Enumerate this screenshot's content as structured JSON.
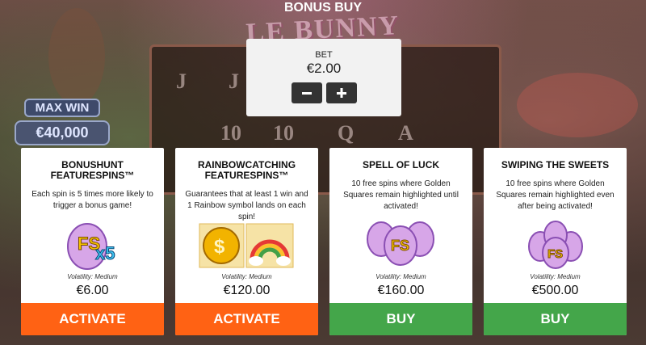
{
  "header": {
    "title": "BONUS BUY"
  },
  "background": {
    "logo_text": "LE BUNNY",
    "max_win_label": "MAX WIN",
    "max_win_value": "€40,000",
    "reel_symbols": [
      "J",
      "J",
      "10",
      "10",
      "Q",
      "A"
    ]
  },
  "bet": {
    "label": "BET",
    "value": "€2.00",
    "decrease_icon": "minus-icon",
    "increase_icon": "plus-icon"
  },
  "colors": {
    "activate": "#ff6214",
    "buy": "#44a64a",
    "panel": "#f2f2f2"
  },
  "cards": [
    {
      "title_line1": "BONUSHUNT",
      "title_line2": "FEATURESPINS™",
      "description": "Each spin is 5 times more likely to trigger a bonus game!",
      "art_text": "FS",
      "art_multiplier": "x5",
      "volatility": "Volatility: Medium",
      "price": "€6.00",
      "action": "ACTIVATE"
    },
    {
      "title_line1": "RAINBOWCATCHING",
      "title_line2": "FEATURESPINS™",
      "description": "Guarantees that at least 1 win and 1 Rainbow symbol lands on each spin!",
      "art_text": "$",
      "volatility": "Volatility: Medium",
      "price": "€120.00",
      "action": "ACTIVATE"
    },
    {
      "title_line1": "SPELL OF LUCK",
      "title_line2": "",
      "description": "10 free spins where Golden Squares remain highlighted until activated!",
      "art_text": "FS",
      "volatility": "Volatility: Medium",
      "price": "€160.00",
      "action": "BUY"
    },
    {
      "title_line1": "SWIPING THE SWEETS",
      "title_line2": "",
      "description": "10 free spins where Golden Squares remain highlighted even after being activated!",
      "art_text": "FS",
      "volatility": "Volatility: Medium",
      "price": "€500.00",
      "action": "BUY"
    }
  ]
}
